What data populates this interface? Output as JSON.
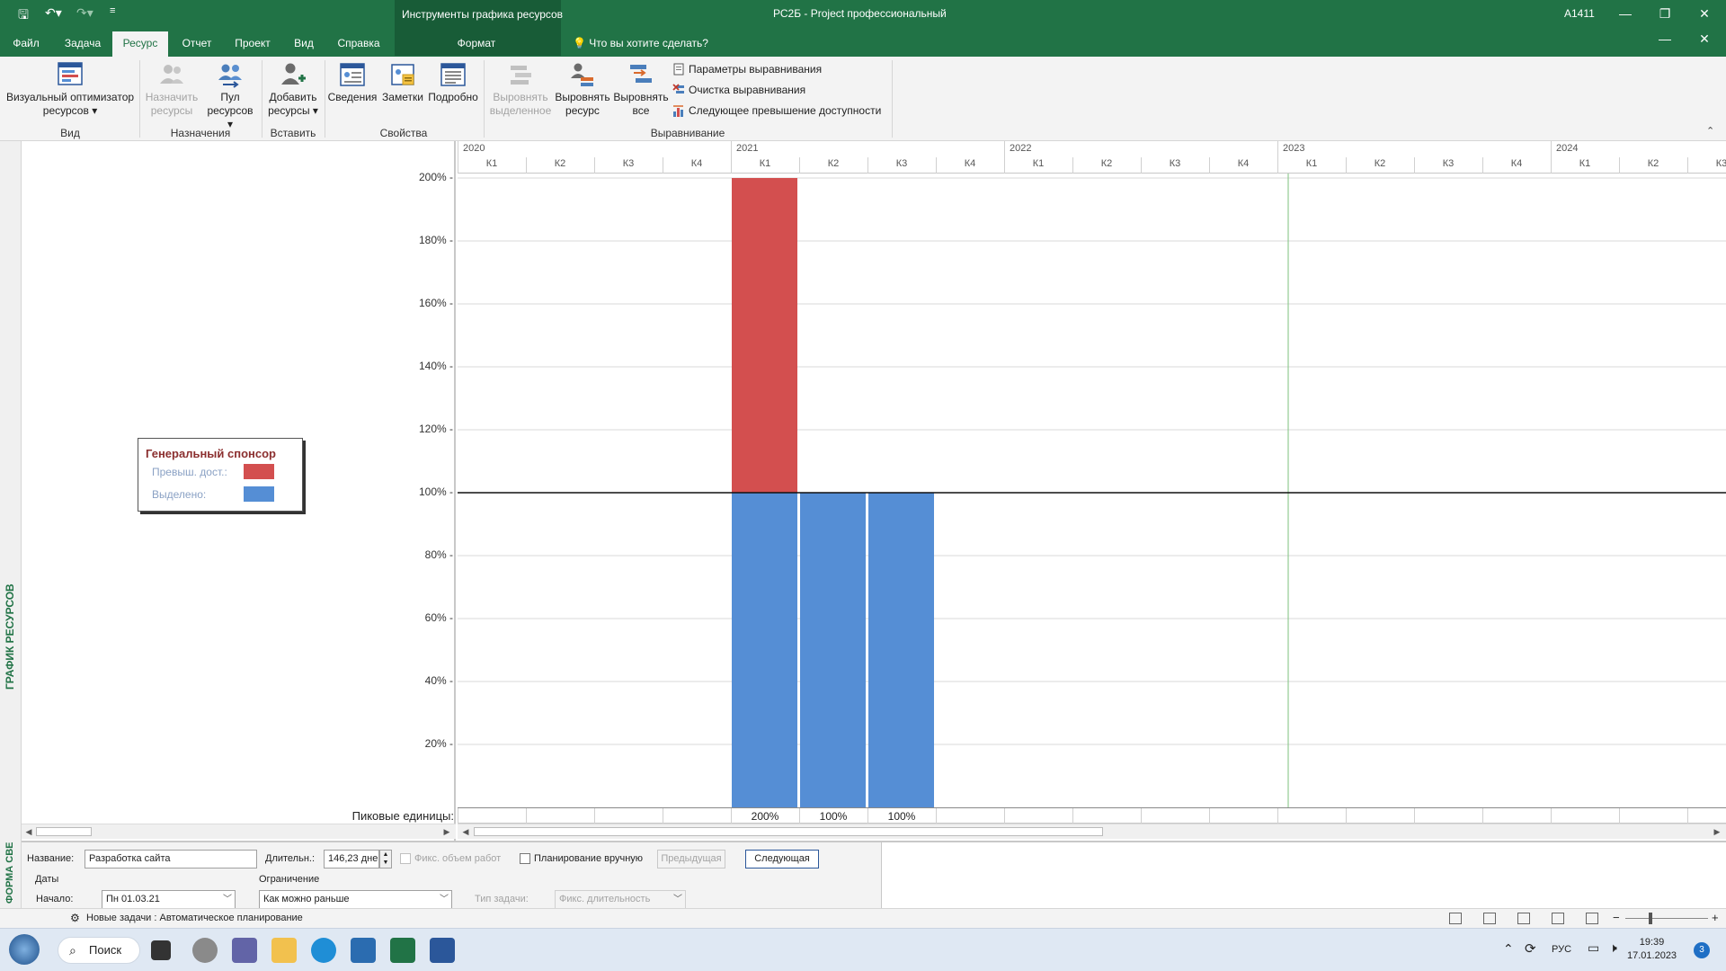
{
  "titlebar": {
    "contextual_title": "Инструменты графика ресурсов",
    "app_title": "РС2Б  -  Project профессиональный",
    "user": "А1411",
    "minimize": "—",
    "restore": "❐",
    "close": "✕"
  },
  "tabs": [
    {
      "label": "Файл"
    },
    {
      "label": "Задача"
    },
    {
      "label": "Ресурс"
    },
    {
      "label": "Отчет"
    },
    {
      "label": "Проект"
    },
    {
      "label": "Вид"
    },
    {
      "label": "Справка"
    }
  ],
  "active_tab": "Ресурс",
  "format_tab": "Формат",
  "tell_me": "Что вы хотите сделать?",
  "ribbon": {
    "view_group": {
      "label": "Вид",
      "visual_optimizer": "Визуальный оптимизатор",
      "visual_optimizer_2": "ресурсов"
    },
    "assign_group": {
      "label": "Назначения",
      "assign_1": "Назначить",
      "assign_2": "ресурсы",
      "pool_1": "Пул",
      "pool_2": "ресурсов"
    },
    "insert_group": {
      "label": "Вставить",
      "add_1": "Добавить",
      "add_2": "ресурсы"
    },
    "props_group": {
      "label": "Свойства",
      "info": "Сведения",
      "notes": "Заметки",
      "details": "Подробно"
    },
    "level_group": {
      "label": "Выравнивание",
      "level_sel_1": "Выровнять",
      "level_sel_2": "выделенное",
      "level_res_1": "Выровнять",
      "level_res_2": "ресурс",
      "level_all_1": "Выровнять",
      "level_all_2": "все",
      "options": "Параметры выравнивания",
      "clear": "Очистка выравнивания",
      "next_over": "Следующее превышение доступности"
    }
  },
  "side_label": "ГРАФИК РЕСУРСОВ",
  "legend": {
    "title": "Генеральный спонсор",
    "over_label": "Превыш. дост.:",
    "alloc_label": "Выделено:",
    "over_color": "#d34f4f",
    "alloc_color": "#558ed5"
  },
  "chart_data": {
    "type": "bar",
    "stacked": true,
    "years": [
      "2020",
      "2021",
      "2022",
      "2023",
      "2024"
    ],
    "quarters": [
      "К1",
      "К2",
      "К3",
      "К4",
      "К1",
      "К2",
      "К3",
      "К4",
      "К1",
      "К2",
      "К3",
      "К4",
      "К1",
      "К2",
      "К3",
      "К4",
      "К1",
      "К2",
      "К3"
    ],
    "y_ticks": [
      "20%",
      "40%",
      "60%",
      "80%",
      "100%",
      "120%",
      "140%",
      "160%",
      "180%",
      "200%"
    ],
    "ylim": [
      0,
      200
    ],
    "availability_line": 100,
    "bars": [
      {
        "year": "2021",
        "quarter": "К1",
        "allocated": 100,
        "overallocated": 100,
        "peak": "200%"
      },
      {
        "year": "2021",
        "quarter": "К2",
        "allocated": 100,
        "overallocated": 0,
        "peak": "100%"
      },
      {
        "year": "2021",
        "quarter": "К3",
        "allocated": 100,
        "overallocated": 0,
        "peak": "100%"
      }
    ],
    "peak_row_label": "Пиковые единицы:"
  },
  "form": {
    "side_label": "ФОРМА СВЕ",
    "name_label": "Название:",
    "name_value": "Разработка сайта",
    "duration_label": "Длительн.:",
    "duration_value": "146,23 дне",
    "fixed_work": "Фикс. объем работ",
    "manual": "Планирование вручную",
    "prev": "Предыдущая",
    "next": "Следующая",
    "dates_label": "Даты",
    "start_label": "Начало:",
    "start_value": "Пн 01.03.21",
    "constraint_label": "Ограничение",
    "constraint_value": "Как можно раньше",
    "task_type_label": "Тип задачи:",
    "task_type_value": "Фикс. длительность"
  },
  "status": {
    "text": "Новые задачи : Автоматическое планирование",
    "zoom_minus": "−",
    "zoom_plus": "+"
  },
  "taskbar": {
    "search": "Поиск",
    "lang": "РУС",
    "time": "19:39",
    "date": "17.01.2023",
    "badge": "3"
  }
}
